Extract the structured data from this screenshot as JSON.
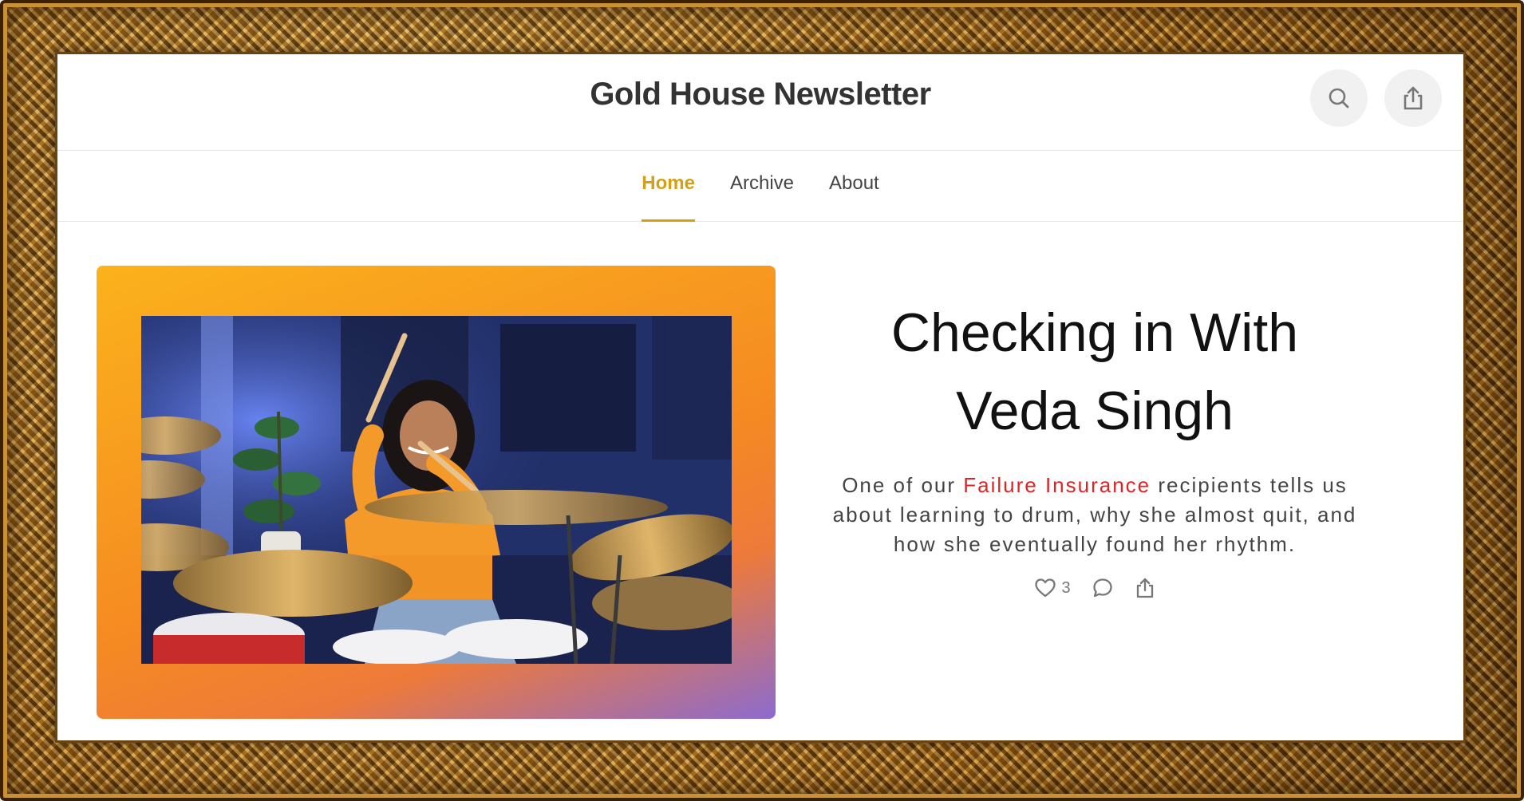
{
  "site": {
    "title": "Gold House Newsletter"
  },
  "nav": {
    "items": [
      {
        "label": "Home",
        "active": true
      },
      {
        "label": "Archive",
        "active": false
      },
      {
        "label": "About",
        "active": false
      }
    ],
    "accent_color": "#d4a017"
  },
  "header_icons": [
    "search-icon",
    "share-icon"
  ],
  "post": {
    "title_line1": "Checking in With",
    "title_line2": "Veda Singh",
    "subtitle_before": "One of our ",
    "subtitle_link": "Failure Insurance",
    "subtitle_after": " recipients tells us about learning to drum, why she almost quit, and how she eventually found her rhythm.",
    "link_color": "#e02424",
    "like_count": "3",
    "action_icons": [
      "heart-icon",
      "comment-icon",
      "share-icon"
    ]
  }
}
